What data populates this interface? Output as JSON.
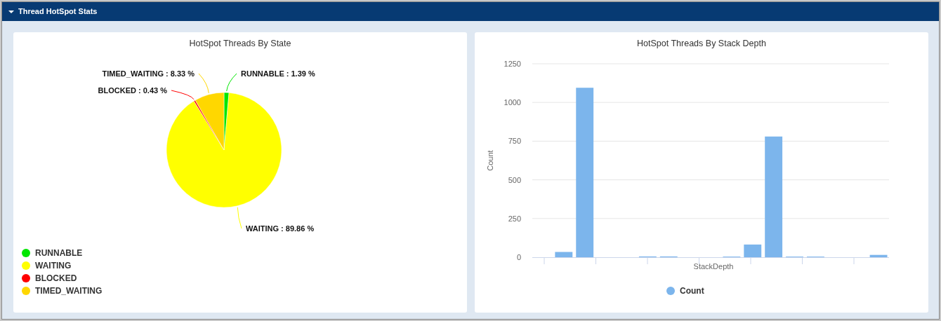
{
  "panel": {
    "title": "Thread HotSpot Stats",
    "expanded": true
  },
  "charts": [
    {
      "chart_data": {
        "type": "pie",
        "title": "HotSpot Threads By State",
        "categories": [
          "RUNNABLE",
          "WAITING",
          "BLOCKED",
          "TIMED_WAITING"
        ],
        "series": [
          {
            "values": [
              1.39,
              89.86,
              0.43,
              8.33
            ]
          }
        ],
        "value_labels": [
          "RUNNABLE : 1.39 %",
          "WAITING : 89.86 %",
          "BLOCKED : 0.43 %",
          "TIMED_WAITING : 8.33 %"
        ],
        "legend": true
      },
      "slices": [
        {
          "color": "#00e600"
        },
        {
          "color": "#ffff00"
        },
        {
          "color": "#ff0000"
        },
        {
          "color": "#ffd700"
        }
      ]
    },
    {
      "chart_data": {
        "type": "bar",
        "title": "HotSpot Threads By Stack Depth",
        "xlabel": "StackDepth",
        "ylabel": "Count",
        "ylim": [
          0,
          1250
        ],
        "yticks": [
          0,
          250,
          500,
          750,
          1000,
          1250
        ],
        "grid": true,
        "legend": true,
        "series": [
          {
            "name": "Count",
            "color": "#7cb5ec",
            "values": [
              0,
              34,
              1095,
              0,
              0,
              5,
              5,
              0,
              0,
              4,
              82,
              780,
              4,
              4,
              0,
              0,
              15
            ]
          }
        ]
      }
    }
  ]
}
